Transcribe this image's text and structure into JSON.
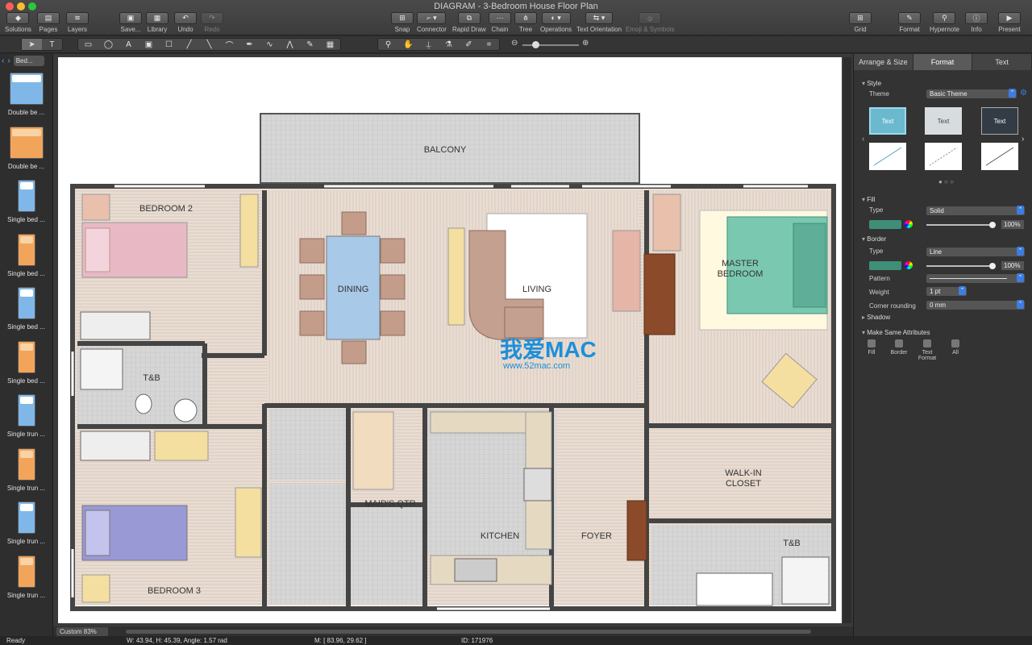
{
  "window": {
    "title": "DIAGRAM - 3-Bedroom House Floor Plan"
  },
  "toolbar": {
    "left": [
      {
        "label": "Solutions",
        "icon": "solutions-icon"
      },
      {
        "label": "Pages",
        "icon": "pages-icon"
      },
      {
        "label": "Layers",
        "icon": "layers-icon"
      },
      {
        "label": "Save...",
        "icon": "save-icon"
      },
      {
        "label": "Library",
        "icon": "library-icon"
      },
      {
        "label": "Undo",
        "icon": "undo-icon"
      },
      {
        "label": "Redo",
        "icon": "redo-icon"
      }
    ],
    "center": [
      {
        "label": "Snap",
        "icon": "snap-icon"
      },
      {
        "label": "Connector",
        "icon": "connector-icon"
      },
      {
        "label": "Rapid Draw",
        "icon": "rapid-draw-icon"
      },
      {
        "label": "Chain",
        "icon": "chain-icon"
      },
      {
        "label": "Tree",
        "icon": "tree-icon"
      },
      {
        "label": "Operations",
        "icon": "operations-icon"
      },
      {
        "label": "Text Orientation",
        "icon": "text-orientation-icon"
      },
      {
        "label": "Emoji & Symbols",
        "icon": "emoji-symbols-icon"
      }
    ],
    "right": [
      {
        "label": "Grid",
        "icon": "grid-icon"
      },
      {
        "label": "Format",
        "icon": "format-icon"
      },
      {
        "label": "Hypernote",
        "icon": "hypernote-icon"
      },
      {
        "label": "Info",
        "icon": "info-icon"
      },
      {
        "label": "Present",
        "icon": "present-icon"
      }
    ]
  },
  "library": {
    "selected": "Bed...",
    "items": [
      {
        "label": "Double be ..."
      },
      {
        "label": "Double be ..."
      },
      {
        "label": "Single bed ..."
      },
      {
        "label": "Single bed ..."
      },
      {
        "label": "Single bed ..."
      },
      {
        "label": "Single bed ..."
      },
      {
        "label": "Single trun ..."
      },
      {
        "label": "Single trun ..."
      },
      {
        "label": "Single trun ..."
      },
      {
        "label": "Single trun ..."
      }
    ]
  },
  "floorplan": {
    "rooms": {
      "balcony": "BALCONY",
      "bedroom2": "BEDROOM 2",
      "dining": "DINING",
      "living": "LIVING",
      "master1": "MASTER",
      "master2": "BEDROOM",
      "tb1": "T&B",
      "maids": "MAID'S QTR",
      "kitchen": "KITCHEN",
      "foyer": "FOYER",
      "walkin1": "WALK-IN",
      "walkin2": "CLOSET",
      "tb2": "T&B",
      "bedroom3": "BEDROOM 3"
    },
    "watermark": {
      "main": "我爱MAC",
      "sub": "www.52mac.com"
    }
  },
  "canvas": {
    "zoom": "Custom 83%"
  },
  "panel": {
    "tabs": [
      "Arrange & Size",
      "Format",
      "Text"
    ],
    "active_tab": "Format",
    "style": {
      "heading": "Style",
      "theme_label": "Theme",
      "theme_value": "Basic Theme",
      "card_text": "Text"
    },
    "fill": {
      "heading": "Fill",
      "type_label": "Type",
      "type_value": "Solid",
      "opacity": "100%",
      "color": "#3f8f78"
    },
    "border": {
      "heading": "Border",
      "type_label": "Type",
      "type_value": "Line",
      "opacity": "100%",
      "pattern_label": "Pattern",
      "weight_label": "Weight",
      "weight_value": "1 pt",
      "corner_label": "Corner rounding",
      "corner_value": "0 mm"
    },
    "shadow": {
      "heading": "Shadow"
    },
    "make_same": {
      "heading": "Make Same Attributes",
      "items": [
        "Fill",
        "Border",
        "Text Format",
        "All"
      ]
    }
  },
  "status": {
    "ready": "Ready",
    "dims": "W: 43.94,  H: 45.39,  Angle: 1.57 rad",
    "mouse": "M: [ 83.96, 29.62 ]",
    "id": "ID: 171976"
  }
}
